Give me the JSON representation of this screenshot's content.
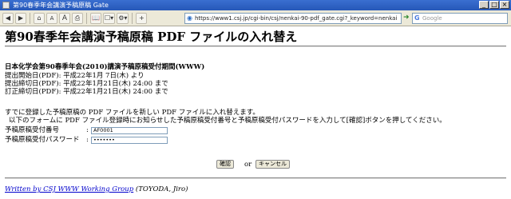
{
  "window": {
    "title": "第90春季年会講演予稿原稿 Gate",
    "buttons": [
      "_",
      "□",
      "×"
    ]
  },
  "toolbar": {
    "back": "◀",
    "forward": "▶",
    "home": "⌂",
    "font_small": "A",
    "font_large": "A",
    "print": "⎙",
    "bookmark": "📖",
    "page": "☐▾",
    "tools": "⚙▾",
    "add": "+",
    "address": "https://www1.csj.jp/cgi-bin/csj/nenkai-90-pdf_gate.cgi?_keyword=nenkai",
    "go": "➜",
    "search_placeholder": "Google",
    "search_icon": "G"
  },
  "page": {
    "heading": "第90春季年会講演予稿原稿 PDF ファイルの入れ替え",
    "period_title": "日本化学会第90春季年会(2010)講演予稿原稿受付期間(WWW)",
    "start": "提出開始日(PDF): 平成22年1月 7日(木) より",
    "deadline": "提出締切日(PDF): 平成22年1月21日(木) 24:00 まで",
    "correction_deadline": "訂正締切日(PDF): 平成22年1月21日(木) 24:00 まで",
    "instruction1": "すでに登録した予稿原稿の PDF ファイルを新しい PDF ファイルに入れ替えます。",
    "instruction2": "以下のフォームに PDF ファイル登録時にお知らせした予稿原稿受付番号と予稿原稿受付パスワードを入力して[確認]ボタンを押してください。",
    "receipt_label": "予稿原稿受付番号",
    "receipt_colon": ":",
    "receipt_value": "AF0001",
    "password_label": "予稿原稿受付パスワード",
    "password_colon": ":",
    "password_value": "•••••••",
    "confirm_button": "確認",
    "or_text": "or",
    "cancel_button": "キャンセル",
    "footer_link": "Written by CSJ WWW Working Group",
    "footer_author": "(TOYODA, Jiro)"
  }
}
